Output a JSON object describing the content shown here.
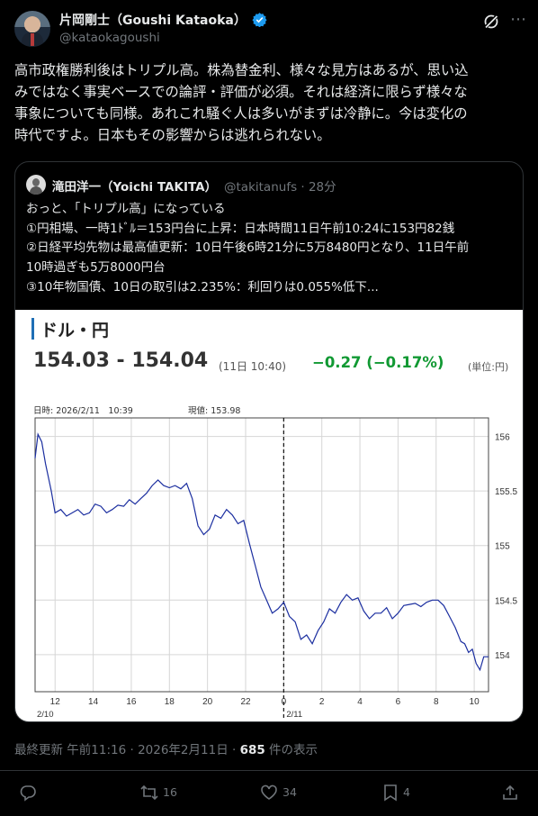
{
  "author": {
    "display_name": "片岡剛士（Goushi Kataoka）",
    "handle": "@kataokagoushi"
  },
  "tweet_text": "高市政権勝利後はトリプル高。株為替金利、様々な見方はあるが、思い込\nみではなく事実ベースでの論評・評価が必須。それは経済に限らず様々な\n事象についても同様。あれこれ騒ぐ人は多いがまずは冷静に。今は変化の\n時代ですよ。日本もその影響からは逃れられない。",
  "quote": {
    "display_name": "滝田洋一（Yoichi TAKITA）",
    "handle_time": "@takitanufs · 28分",
    "text": "おっと、「トリプル高」になっている\n①円相場、一時1ﾄﾞﾙ＝153円台に上昇：日本時間11日午前10:24に153円82銭\n②日経平均先物は最高値更新：10日午後6時21分に5万8480円となり、11日午前\n10時過ぎも5万8000円台\n③10年物国債、10日の取引は2.235%：利回りは0.055%低下..."
  },
  "chart_card": {
    "title": "ドル・円",
    "price": "154.03 - 154.04",
    "time": "(11日 10:40)",
    "change": "−0.27 (−0.17%)",
    "unit": "(単位:円)",
    "date_label": "日時: 2026/2/11　10:39",
    "genne_label": "現値: 153.98"
  },
  "chart_data": {
    "type": "line",
    "ylim": [
      153.66,
      156.17
    ],
    "yticks": [
      154,
      154.5,
      155,
      155.5,
      156
    ],
    "ytick_labels": [
      "154",
      "154.5",
      "155",
      "155.5",
      "156"
    ],
    "xlim": [
      10.95,
      34.75
    ],
    "xticks": [
      12,
      14,
      16,
      18,
      20,
      22,
      24,
      26,
      28,
      30,
      32,
      34
    ],
    "xtick_labels": [
      "12",
      "14",
      "16",
      "18",
      "20",
      "22",
      "0",
      "2",
      "4",
      "6",
      "8",
      "10"
    ],
    "day_labels": [
      "2/10",
      "2/11"
    ],
    "divider_x": 24,
    "grid": true,
    "color": "#1c2fa0",
    "series": [
      {
        "x": [
          10.95,
          11.1,
          11.3,
          11.5,
          11.8,
          12.0,
          12.3,
          12.6,
          12.9,
          13.2,
          13.5,
          13.8,
          14.1,
          14.4,
          14.7,
          15.0,
          15.3,
          15.6,
          15.9,
          16.2,
          16.5,
          16.8,
          17.1,
          17.4,
          17.7,
          18.0,
          18.3,
          18.6,
          18.9,
          19.2,
          19.5,
          19.8,
          20.1,
          20.4,
          20.7,
          21.0,
          21.3,
          21.6,
          21.9,
          22.2,
          22.5,
          22.8,
          23.1,
          23.4,
          23.7,
          24.0,
          24.3,
          24.6,
          24.9,
          25.2,
          25.5,
          25.8,
          26.1,
          26.4,
          26.7,
          27.0,
          27.3,
          27.6,
          27.9,
          28.2,
          28.5,
          28.8,
          29.1,
          29.4,
          29.7,
          30.0,
          30.3,
          30.6,
          30.9,
          31.2,
          31.5,
          31.8,
          32.1,
          32.4,
          32.7,
          33.0,
          33.3,
          33.5,
          33.7,
          33.9,
          34.1,
          34.3,
          34.5,
          34.75
        ],
        "y": [
          155.8,
          156.02,
          155.95,
          155.75,
          155.5,
          155.3,
          155.33,
          155.27,
          155.3,
          155.33,
          155.28,
          155.3,
          155.38,
          155.36,
          155.3,
          155.33,
          155.37,
          155.36,
          155.42,
          155.38,
          155.43,
          155.48,
          155.55,
          155.6,
          155.55,
          155.53,
          155.55,
          155.52,
          155.57,
          155.43,
          155.18,
          155.1,
          155.15,
          155.28,
          155.25,
          155.33,
          155.28,
          155.2,
          155.23,
          155.02,
          154.82,
          154.62,
          154.5,
          154.38,
          154.42,
          154.48,
          154.35,
          154.3,
          154.14,
          154.18,
          154.1,
          154.22,
          154.3,
          154.42,
          154.38,
          154.48,
          154.55,
          154.5,
          154.52,
          154.4,
          154.33,
          154.38,
          154.38,
          154.43,
          154.33,
          154.38,
          154.45,
          154.46,
          154.47,
          154.44,
          154.48,
          154.5,
          154.5,
          154.45,
          154.35,
          154.25,
          154.12,
          154.1,
          154.02,
          154.05,
          153.92,
          153.86,
          153.98,
          153.98
        ]
      }
    ]
  },
  "footer": {
    "meta_prefix": "最終更新 午前11:16 · 2026年2月11日 · ",
    "views_count": "685",
    "views_suffix": " 件の表示"
  },
  "actions": {
    "retweets": "16",
    "likes": "34",
    "bookmarks": "4"
  }
}
